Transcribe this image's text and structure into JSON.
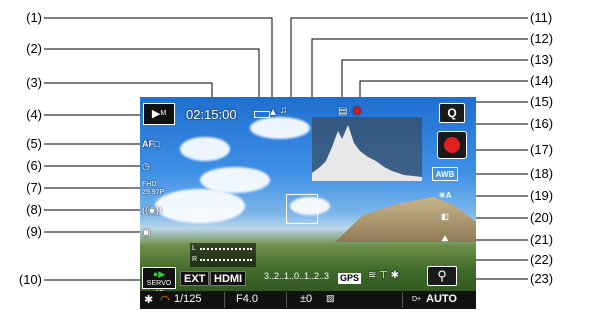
{
  "callouts_left": [
    "(1)",
    "(2)",
    "(3)",
    "(4)",
    "(5)",
    "(6)",
    "(7)",
    "(8)",
    "(9)",
    "(10)"
  ],
  "callouts_right": [
    "(11)",
    "(12)",
    "(13)",
    "(14)",
    "(15)",
    "(16)",
    "(17)",
    "(18)",
    "(19)",
    "(20)",
    "(21)",
    "(22)",
    "(23)"
  ],
  "screen": {
    "mode_label": "M",
    "record_time": "02:15:00",
    "af_label": "AF□",
    "servo_label": "SERVO AF",
    "ext_label": "EXT",
    "hdmi_label": "HDMI",
    "gps_label": "GPS",
    "q_label": "Q",
    "awb_label": "AWB",
    "level_label": "3..2..1..0..1..2..3",
    "audio_l": "L",
    "audio_r": "R",
    "shutter": "1/125",
    "aperture": "F4.0",
    "exposure": "±0",
    "iso": "AUTO",
    "iso_prefix": "D+",
    "fhd_label": "FHD",
    "fps_label": "29.97P",
    "zoom_icon": "magnifier-icon"
  },
  "colors": {
    "record_dot": "#e02020",
    "screen_bar": "#111111"
  }
}
